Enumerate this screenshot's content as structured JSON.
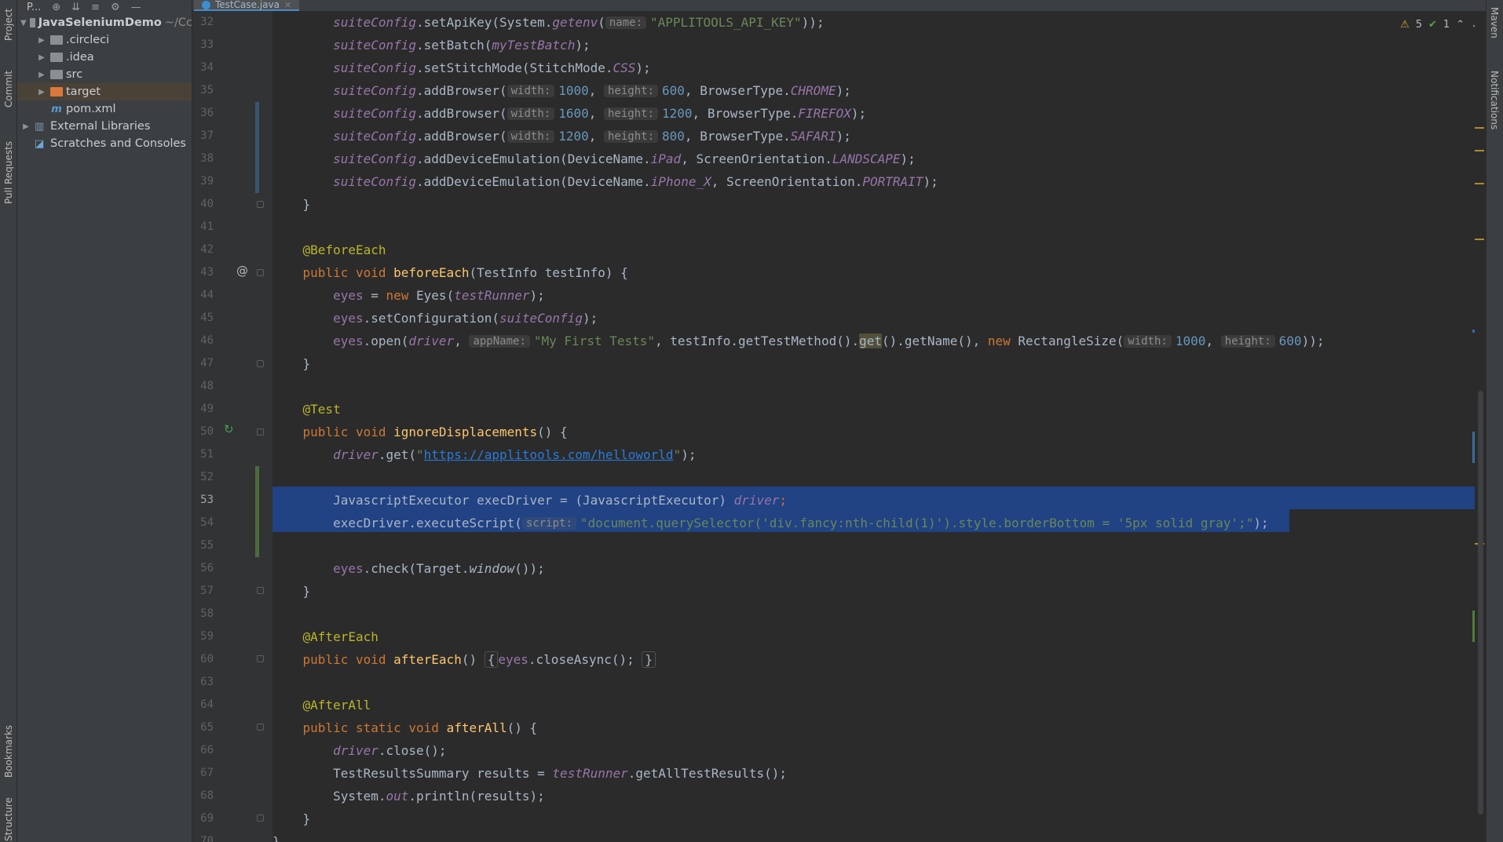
{
  "left_tabs": {
    "project": "Project",
    "commit": "Commit",
    "pull_requests": "Pull Requests",
    "bookmarks": "Bookmarks",
    "structure": "Structure"
  },
  "right_tabs": {
    "maven": "Maven",
    "notifications": "Notifications"
  },
  "project_panel": {
    "title": "P...",
    "tree": [
      {
        "label": "JavaSeleniumDemo",
        "suffix": "~/Cc"
      },
      {
        "label": ".circleci"
      },
      {
        "label": ".idea"
      },
      {
        "label": "src"
      },
      {
        "label": "target"
      },
      {
        "label": "pom.xml"
      },
      {
        "label": "External Libraries"
      },
      {
        "label": "Scratches and Consoles"
      }
    ]
  },
  "editor_tab": {
    "filename": "TestCase.java"
  },
  "problems": {
    "warnings": "5",
    "ok": "1"
  },
  "line_numbers": [
    "32",
    "33",
    "34",
    "35",
    "36",
    "37",
    "38",
    "39",
    "40",
    "41",
    "42",
    "43",
    "44",
    "45",
    "46",
    "47",
    "48",
    "49",
    "50",
    "51",
    "52",
    "53",
    "54",
    "55",
    "56",
    "57",
    "58",
    "59",
    "60",
    "63",
    "64",
    "65",
    "66",
    "67",
    "68",
    "69",
    "70"
  ],
  "current_line": "53",
  "code": {
    "l32": {
      "a": "suiteConfig",
      "b": ".setApiKey(System.",
      "c": "getenv",
      "d": "(",
      "hint": "name:",
      "e": "\"APPLITOOLS_API_KEY\"",
      "f": "));"
    },
    "l33": {
      "a": "suiteConfig",
      "b": ".setBatch(",
      "c": "myTestBatch",
      "d": ");"
    },
    "l34": {
      "a": "suiteConfig",
      "b": ".setStitchMode(StitchMode.",
      "c": "CSS",
      "d": ");"
    },
    "l35": {
      "a": "suiteConfig",
      "b": ".addBrowser(",
      "h1": "width:",
      "n1": "1000",
      "s1": ", ",
      "h2": "height:",
      "n2": "600",
      "s2": ", BrowserType.",
      "c": "CHROME",
      "d": ");"
    },
    "l36": {
      "a": "suiteConfig",
      "b": ".addBrowser(",
      "h1": "width:",
      "n1": "1600",
      "s1": ", ",
      "h2": "height:",
      "n2": "1200",
      "s2": ", BrowserType.",
      "c": "FIREFOX",
      "d": ");"
    },
    "l37": {
      "a": "suiteConfig",
      "b": ".addBrowser(",
      "h1": "width:",
      "n1": "1200",
      "s1": ", ",
      "h2": "height:",
      "n2": "800",
      "s2": ", BrowserType.",
      "c": "SAFARI",
      "d": ");"
    },
    "l38": {
      "a": "suiteConfig",
      "b": ".addDeviceEmulation(DeviceName.",
      "c": "iPad",
      "d": ", ScreenOrientation.",
      "e": "LANDSCAPE",
      "f": ");"
    },
    "l39": {
      "a": "suiteConfig",
      "b": ".addDeviceEmulation(DeviceName.",
      "c": "iPhone_X",
      "d": ", ScreenOrientation.",
      "e": "PORTRAIT",
      "f": ");"
    },
    "l40": {
      "a": "}"
    },
    "l42": {
      "a": "@BeforeEach"
    },
    "l43": {
      "kw": "public void ",
      "m": "beforeEach",
      "rest": "(TestInfo testInfo) {"
    },
    "l44": {
      "a": "eyes",
      "b": " = ",
      "kw": "new ",
      "c": "Eyes(",
      "d": "testRunner",
      "e": ");"
    },
    "l45": {
      "a": "eyes",
      "b": ".setConfiguration(",
      "c": "suiteConfig",
      "d": ");"
    },
    "l46": {
      "a": "eyes",
      "b": ".open(",
      "c": "driver",
      "d": ", ",
      "h1": "appName:",
      "s": "\"My First Tests\"",
      "e": ", testInfo.getTestMethod().",
      "g": "get",
      "f": "().getName(), ",
      "kw": "new ",
      "r": "RectangleSize(",
      "h2": "width:",
      "n1": "1000",
      "s1": ", ",
      "h3": "height:",
      "n2": "600",
      "z": "));"
    },
    "l47": {
      "a": "}"
    },
    "l49": {
      "a": "@Test"
    },
    "l50": {
      "kw": "public void ",
      "m": "ignoreDisplacements",
      "rest": "() {"
    },
    "l51": {
      "a": "driver",
      "b": ".get(",
      "q1": "\"",
      "url": "https://applitools.com/helloworld",
      "q2": "\"",
      "c": ");"
    },
    "l53": {
      "a": "JavascriptExecutor execDriver = (JavascriptExecutor) ",
      "b": "driver",
      "c": ";"
    },
    "l54": {
      "a": "execDriver.executeScript(",
      "hint": "script:",
      "s": "\"document.querySelector('div.fancy:nth-child(1)').style.borderBottom = '5px solid gray';\"",
      "c": ");"
    },
    "l56": {
      "a": "eyes",
      "b": ".check(Target.",
      "c": "window",
      "d": "());"
    },
    "l57": {
      "a": "}"
    },
    "l59": {
      "a": "@AfterEach"
    },
    "l60": {
      "kw": "public void ",
      "m": "afterEach",
      "p": "() ",
      "o": "{",
      "e": "eyes",
      "f": ".closeAsync(); ",
      "cl": "}"
    },
    "l64": {
      "a": "@AfterAll"
    },
    "l65": {
      "kw": "public static void ",
      "m": "afterAll",
      "rest": "() {"
    },
    "l66": {
      "a": "driver",
      "b": ".close();"
    },
    "l67": {
      "a": "TestResultsSummary results = ",
      "b": "testRunner",
      "c": ".getAllTestResults();"
    },
    "l68": {
      "a": "System.",
      "b": "out",
      "c": ".println(results);"
    },
    "l69": {
      "a": "}"
    },
    "l70": {
      "a": "}"
    }
  },
  "colors": {
    "keyword": "#cc7832",
    "annotation": "#bbb529",
    "field": "#9876aa",
    "string": "#6a8759",
    "number": "#6897bb",
    "method": "#ffc66d",
    "selection": "#214283"
  }
}
